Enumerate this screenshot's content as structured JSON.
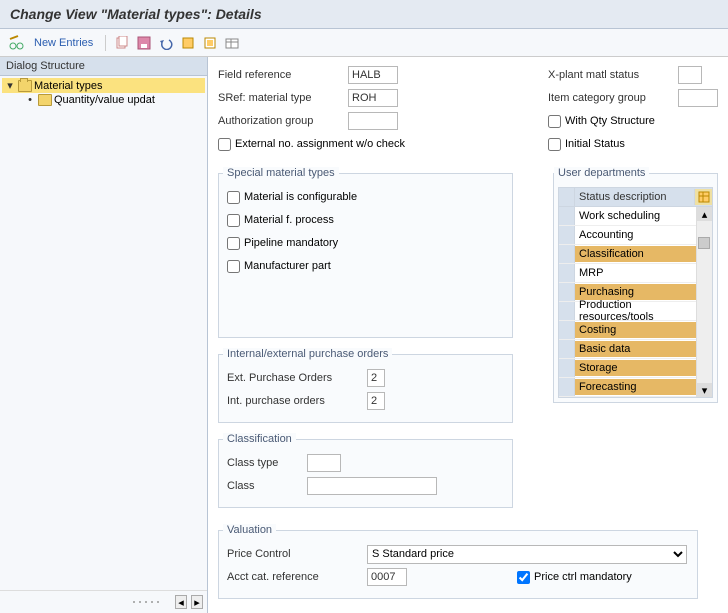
{
  "title": "Change View \"Material types\": Details",
  "toolbar": {
    "new_entries": "New Entries"
  },
  "tree": {
    "header": "Dialog Structure",
    "root": "Material types",
    "child": "Quantity/value updat"
  },
  "general": {
    "field_ref_lbl": "Field reference",
    "field_ref_val": "HALB",
    "sref_lbl": "SRef: material type",
    "sref_val": "ROH",
    "auth_lbl": "Authorization group",
    "auth_val": "",
    "extno_lbl": "External no. assignment w/o check",
    "xplant_lbl": "X-plant matl status",
    "xplant_val": "",
    "itemcat_lbl": "Item category group",
    "itemcat_val": "",
    "withqty_lbl": "With Qty Structure",
    "initstat_lbl": "Initial Status"
  },
  "smt": {
    "legend": "Special material types",
    "configurable": "Material is configurable",
    "process": "Material f. process",
    "pipeline": "Pipeline mandatory",
    "manuf": "Manufacturer part"
  },
  "io": {
    "legend": "Internal/external purchase orders",
    "ext_lbl": "Ext. Purchase Orders",
    "ext_val": "2",
    "int_lbl": "Int. purchase orders",
    "int_val": "2"
  },
  "cls": {
    "legend": "Classification",
    "ctype_lbl": "Class type",
    "ctype_val": "",
    "class_lbl": "Class",
    "class_val": ""
  },
  "val": {
    "legend": "Valuation",
    "pctrl_lbl": "Price Control",
    "pctrl_opt": "S Standard price",
    "acct_lbl": "Acct cat. reference",
    "acct_val": "0007",
    "pmand_lbl": "Price ctrl mandatory"
  },
  "ud": {
    "legend": "User departments",
    "head": "Status description",
    "items": [
      {
        "label": "Work scheduling",
        "sel": false
      },
      {
        "label": "Accounting",
        "sel": false
      },
      {
        "label": "Classification",
        "sel": true
      },
      {
        "label": "MRP",
        "sel": false
      },
      {
        "label": "Purchasing",
        "sel": true
      },
      {
        "label": "Production resources/tools",
        "sel": false
      },
      {
        "label": "Costing",
        "sel": true
      },
      {
        "label": "Basic data",
        "sel": true
      },
      {
        "label": "Storage",
        "sel": true
      },
      {
        "label": "Forecasting",
        "sel": true
      }
    ]
  }
}
